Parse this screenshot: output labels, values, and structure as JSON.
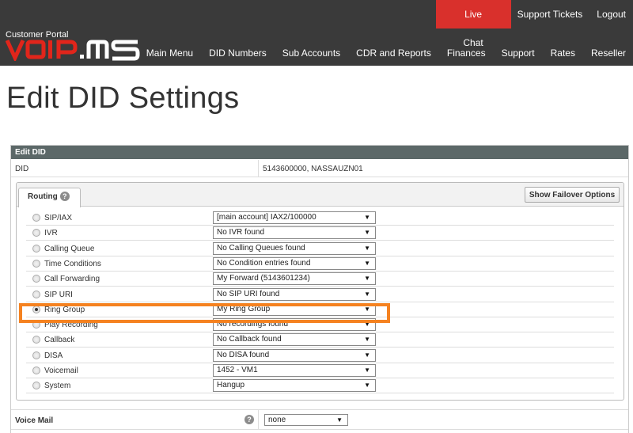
{
  "topbar": {
    "live_chat": "Live Chat",
    "support_tickets": "Support Tickets",
    "logout": "Logout"
  },
  "brand": {
    "portal_label": "Customer Portal",
    "logo_text": "VoIP.ms",
    "colors": {
      "header_bg": "#3a3a3a",
      "live_chat_bg": "#d9302c",
      "logo_red": "#e1251b",
      "highlight": "#f58220"
    }
  },
  "nav": {
    "items": [
      "Main Menu",
      "DID Numbers",
      "Sub Accounts",
      "CDR and Reports",
      "Finances",
      "Support",
      "Rates",
      "Reseller"
    ]
  },
  "page": {
    "title": "Edit DID Settings"
  },
  "edit_did": {
    "header": "Edit DID",
    "did_label": "DID",
    "did_value": "5143600000, NASSAUZN01"
  },
  "routing": {
    "tab_label": "Routing",
    "help_icon": "?",
    "failover_button": "Show Failover Options",
    "rows": [
      {
        "label": "SIP/IAX",
        "value": "[main account] IAX2/100000",
        "checked": false,
        "disabled": false
      },
      {
        "label": "IVR",
        "value": "No IVR found",
        "checked": false,
        "disabled": false
      },
      {
        "label": "Calling Queue",
        "value": "No Calling Queues found",
        "checked": false,
        "disabled": false
      },
      {
        "label": "Time Conditions",
        "value": "No Condition entries found",
        "checked": false,
        "disabled": false
      },
      {
        "label": "Call Forwarding",
        "value": "My Forward (5143601234)",
        "checked": false,
        "disabled": false
      },
      {
        "label": "SIP URI",
        "value": "No SIP URI found",
        "checked": false,
        "disabled": false
      },
      {
        "label": "Ring Group",
        "value": "My Ring Group",
        "checked": true,
        "disabled": false
      },
      {
        "label": "Play Recording",
        "value": "No recordings found",
        "checked": false,
        "disabled": false
      },
      {
        "label": "Callback",
        "value": "No Callback found",
        "checked": false,
        "disabled": false
      },
      {
        "label": "DISA",
        "value": "No DISA found",
        "checked": false,
        "disabled": false
      },
      {
        "label": "Voicemail",
        "value": "1452 - VM1",
        "checked": false,
        "disabled": false
      },
      {
        "label": "System",
        "value": "Hangup",
        "checked": false,
        "disabled": false
      }
    ]
  },
  "voicemail": {
    "label": "Voice Mail",
    "help_icon": "?",
    "value": "none"
  },
  "icons": {
    "dropdown_arrow": "▼"
  }
}
